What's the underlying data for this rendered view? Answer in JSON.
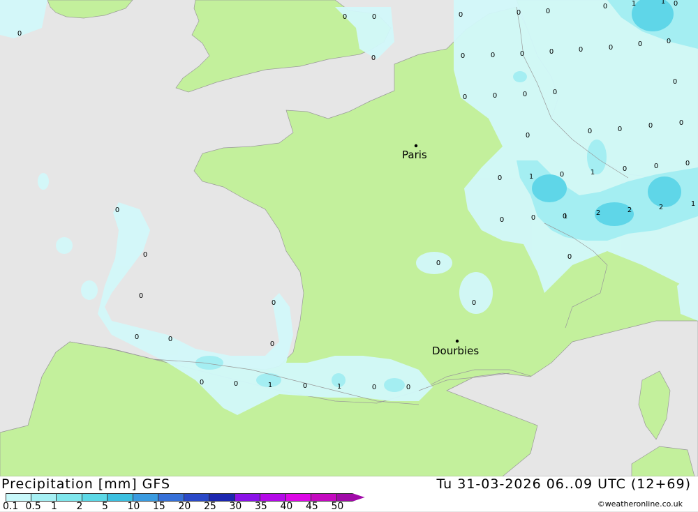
{
  "title": "Precipitation [mm] GFS",
  "datetime": "Tu 31-03-2026 06..09 UTC (12+69)",
  "credit": "©weatheronline.co.uk",
  "cities": [
    {
      "name": "Paris"
    },
    {
      "name": "Dourbies"
    }
  ],
  "values": [
    "0",
    "0",
    "0",
    "0",
    "1",
    "1",
    "0",
    "0",
    "0",
    "0",
    "0",
    "0",
    "0",
    "0",
    "0",
    "0",
    "0",
    "0",
    "0",
    "0",
    "0",
    "0",
    "0",
    "0",
    "0",
    "0",
    "0",
    "0",
    "0",
    "1",
    "0",
    "0",
    "0",
    "0",
    "1",
    "0",
    "0",
    "0",
    "1",
    "2",
    "2",
    "2",
    "1",
    "0",
    "0",
    "0",
    "0",
    "0",
    "0",
    "0",
    "0",
    "0",
    "0",
    "0",
    "0",
    "1",
    "0",
    "1",
    "0",
    "0",
    "0"
  ],
  "legend": {
    "labels": [
      "0.1",
      "0.5",
      "1",
      "2",
      "5",
      "10",
      "15",
      "20",
      "25",
      "30",
      "35",
      "40",
      "45",
      "50"
    ],
    "colors": [
      "#c8f8fa",
      "#a6f0f4",
      "#7fe6ec",
      "#5cd8e6",
      "#3cc0e0",
      "#3a9be0",
      "#3670d8",
      "#2a49c8",
      "#1c26b0",
      "#8a12e8",
      "#b40ae8",
      "#dc08e6",
      "#c40ac0",
      "#a00aa8"
    ]
  },
  "colors": {
    "sea": "#e6e6e6",
    "land": "#c3f09c",
    "precip_light": "#d2f8fa",
    "precip_mid": "#a4eef2",
    "precip_heavy": "#5fd6e8"
  }
}
